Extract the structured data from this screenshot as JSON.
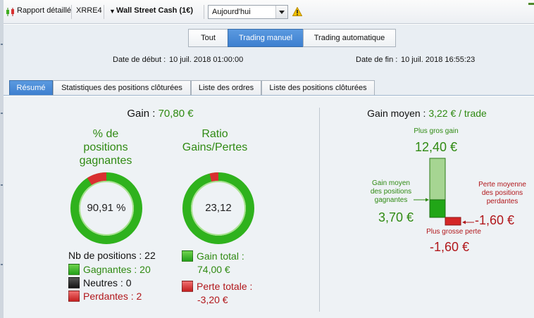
{
  "toolbar": {
    "report_label": "Rapport détaillé",
    "account": "XRRE4",
    "instrument": "Wall Street Cash (1€)",
    "period_value": "Aujourd'hui",
    "icons": {
      "report": "candlestick-icon",
      "instrument_menu": "triangle-down-icon",
      "period": "chevron-down-icon",
      "warning": "warning-icon"
    }
  },
  "header": {
    "segments": [
      "Tout",
      "Trading manuel",
      "Trading automatique"
    ],
    "active_segment": "Trading manuel",
    "start_label": "Date de début :",
    "start_value": "10 juil. 2018 01:00:00",
    "end_label": "Date de fin :",
    "end_value": "10 juil. 2018 16:55:23"
  },
  "tabs": {
    "items": [
      "Résumé",
      "Statistiques des positions clôturées",
      "Liste des ordres",
      "Liste des positions clôturées"
    ],
    "active": "Résumé"
  },
  "summary": {
    "gain_label": "Gain :",
    "gain_value": "70,80 €",
    "win_pct_title_1": "% de",
    "win_pct_title_2": "positions",
    "win_pct_title_3": "gagnantes",
    "win_pct_value": "90,91 %",
    "win_pct_fraction": 0.9091,
    "ratio_title_1": "Ratio",
    "ratio_title_2": "Gains/Pertes",
    "ratio_value": "23,12",
    "ratio_fraction": 0.9586,
    "nb_positions": "Nb de positions : 22",
    "gagnantes": "Gagnantes : 20",
    "neutres": "Neutres : 0",
    "perdantes": "Perdantes : 2",
    "gain_total_label": "Gain total :",
    "gain_total_value": "74,00 €",
    "perte_totale_label": "Perte totale :",
    "perte_totale_value": "-3,20 €"
  },
  "average": {
    "title_label": "Gain moyen :",
    "title_value": "3,22 € / trade",
    "best_label": "Plus gros gain",
    "best_value": "12,40 €",
    "avg_win_label_1": "Gain moyen",
    "avg_win_label_2": "des positions",
    "avg_win_label_3": "gagnantes",
    "avg_win_value": "3,70 €",
    "avg_loss_label_1": "Perte moyenne",
    "avg_loss_label_2": "des positions",
    "avg_loss_label_3": "perdantes",
    "avg_loss_value": "-1,60 €",
    "worst_label": "Plus grosse perte",
    "worst_value": "-1,60 €",
    "bar_scale": {
      "max_gain": 12.4,
      "avg_gain": 3.7,
      "avg_loss": 1.6,
      "max_loss": 1.6
    }
  },
  "colors": {
    "win": "#2f8a12",
    "loss": "#b1171b",
    "accent": "#3d7fcf"
  }
}
